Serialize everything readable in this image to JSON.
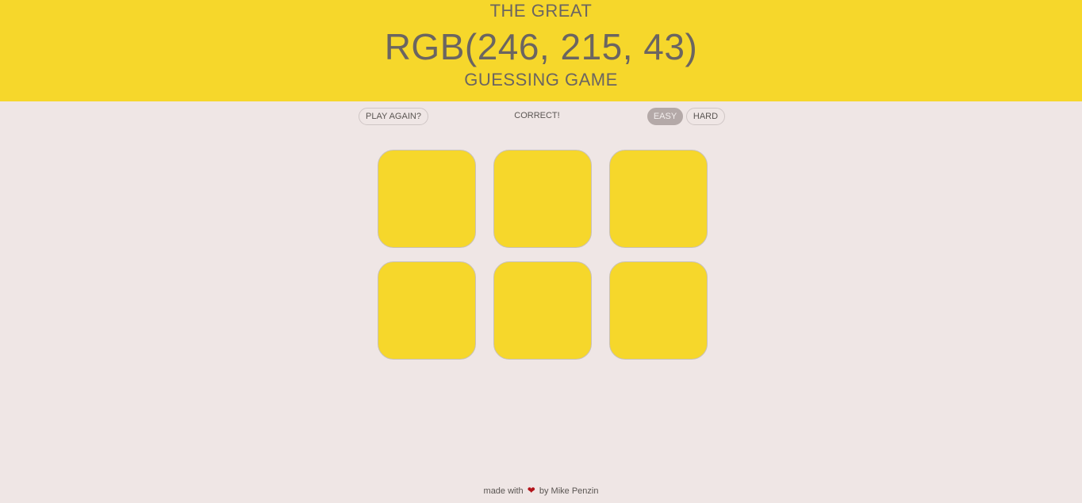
{
  "header": {
    "line1": "THE GREAT",
    "rgb": "RGB(246, 215, 43)",
    "line3": "GUESSING GAME",
    "background_color": "#f6d72b"
  },
  "controls": {
    "play_again_label": "PLAY AGAIN?",
    "message": "CORRECT!",
    "easy_label": "EASY",
    "hard_label": "HARD",
    "selected_mode": "EASY"
  },
  "squares": [
    {
      "color": "#f6d72b"
    },
    {
      "color": "#f6d72b"
    },
    {
      "color": "#f6d72b"
    },
    {
      "color": "#f6d72b"
    },
    {
      "color": "#f6d72b"
    },
    {
      "color": "#f6d72b"
    }
  ],
  "footer": {
    "prefix": "made with",
    "icon": "heart-icon",
    "suffix": "by Mike Penzin"
  }
}
